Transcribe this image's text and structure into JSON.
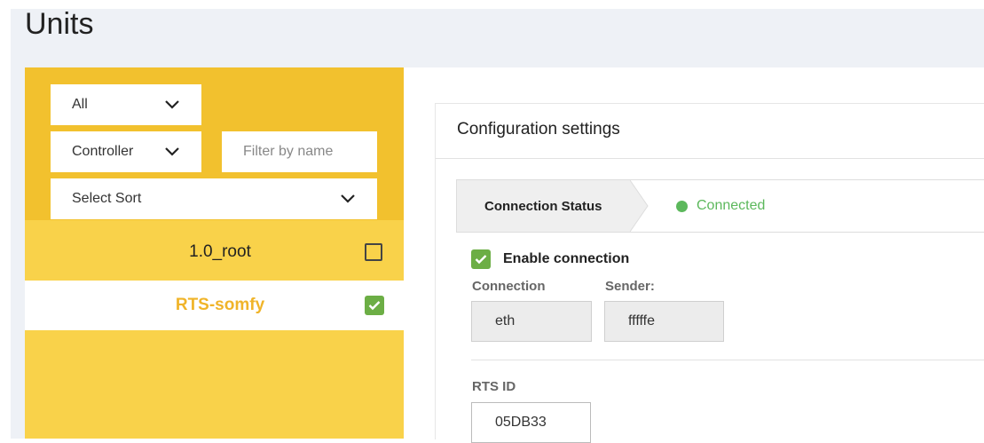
{
  "page": {
    "title": "Units"
  },
  "filters": {
    "type_select": "All",
    "category_select": "Controller",
    "name_filter_placeholder": "Filter by name",
    "sort_select": "Select Sort"
  },
  "units": [
    {
      "name": "1.0_root",
      "checked": false,
      "active": false
    },
    {
      "name": "RTS-somfy",
      "checked": true,
      "active": true
    }
  ],
  "config": {
    "title": "Configuration settings",
    "status_label": "Connection Status",
    "status_value": "Connected",
    "enable_label": "Enable connection",
    "enable_checked": true,
    "connection_label": "Connection",
    "connection_value": "eth",
    "sender_label": "Sender:",
    "sender_value": "fffffe",
    "rts_id_label": "RTS ID",
    "rts_id_value": "05DB33"
  },
  "colors": {
    "sidebar_bg": "#f9d24a",
    "filters_bg": "#f2c12e",
    "active_text": "#f0b429",
    "check_green": "#6cae45",
    "connected_green": "#5cb85c"
  }
}
